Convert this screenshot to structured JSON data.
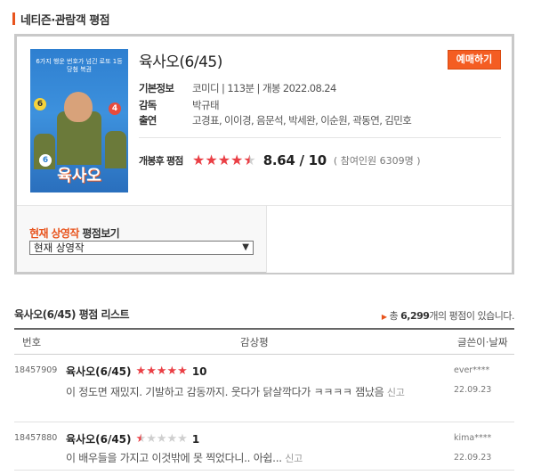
{
  "section_title": "네티즌·관람객 평점",
  "movie": {
    "title": "육사오(6/45)",
    "reserve_label": "예매하기",
    "poster_title": "육사오",
    "poster_tagline": "6가지 행운 번호가 넘긴 로또 1등 당첨 복권",
    "info": [
      {
        "label": "기본정보",
        "value": "코미디 | 113분 | 개봉 2022.08.24"
      },
      {
        "label": "감독",
        "value": "박규태"
      },
      {
        "label": "출연",
        "value": "고경표, 이이경, 음문석, 박세완, 이순원, 곽동연, 김민호"
      }
    ],
    "rating_label": "개봉후 평점",
    "rating_stars": 4.32,
    "score": "8.64",
    "score_of": "/ 10",
    "participants": "( 참여인원 6309명 )"
  },
  "view": {
    "highlight": "현재 상영작",
    "label_rest": " 평점보기",
    "select_value": "현재 상영작"
  },
  "list": {
    "heading": "육사오(6/45) 평점 리스트",
    "count_prefix": "총 ",
    "count_value": "6,299",
    "count_suffix": "개의 평점이 있습니다.",
    "columns": [
      "번호",
      "감상평",
      "글쓴이·날짜"
    ],
    "rows": [
      {
        "num": "18457909",
        "title": "육사오(6/45)",
        "stars": 5,
        "point": "10",
        "text": "이 정도면 재밌지. 기발하고 감동까지. 웃다가 닭살깍다가 ㅋㅋㅋㅋ 잼났음",
        "report": "신고",
        "user": "ever****",
        "date": "22.09.23"
      },
      {
        "num": "18457880",
        "title": "육사오(6/45)",
        "stars": 0.5,
        "point": "1",
        "text": "이 배우들을 가지고 이것밖에 못 찍었다니.. 아쉽...",
        "report": "신고",
        "user": "kima****",
        "date": "22.09.23"
      }
    ]
  },
  "colors": {
    "accent": "#e8541d",
    "star": "#ea3f45",
    "button": "#f45d22"
  }
}
